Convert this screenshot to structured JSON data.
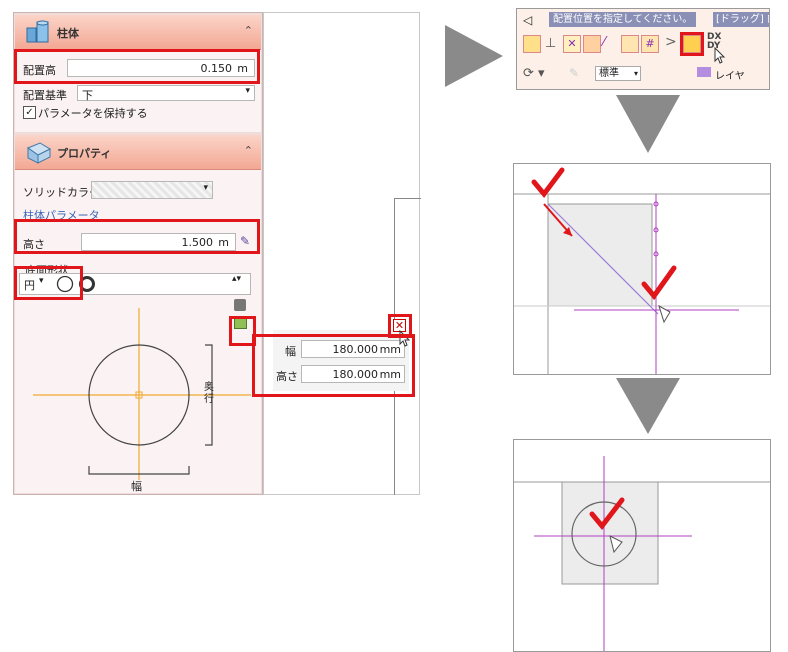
{
  "panel": {
    "column_section": {
      "title": "柱体",
      "height_label": "配置高",
      "height_value": "0.150",
      "height_unit": "m",
      "base_label": "配置基準",
      "base_value": "下",
      "keep_params_label": "パラメータを保持する"
    },
    "property_section": {
      "title": "プロパティ",
      "solid_color_label": "ソリッドカラー",
      "column_params_label": "柱体パラメータ",
      "height_label": "高さ",
      "height_value": "1.500",
      "height_unit": "m",
      "bottom_shape_label": "底面形状",
      "shape_select_value": "円",
      "width_axis_label": "幅",
      "depth_axis_label": "奥行"
    }
  },
  "popup": {
    "width_label": "幅",
    "width_value": "180.000",
    "width_unit": "mm",
    "height_label": "高さ",
    "height_value": "180.000",
    "height_unit": "mm"
  },
  "toolbar_shot": {
    "hint_text": "配置位置を指定してください。",
    "drag_hint": "[ドラッグ] 向き",
    "standard_label": "標準",
    "dxdy_label": "DX DY",
    "layer_label": "レイヤ"
  },
  "colors": {
    "highlight_red": "#e0161b",
    "panel_bg": "#f1dcdc",
    "section_header": "#f3a894",
    "axis_orange": "#f0a830",
    "guide_purple": "#b040c0"
  }
}
